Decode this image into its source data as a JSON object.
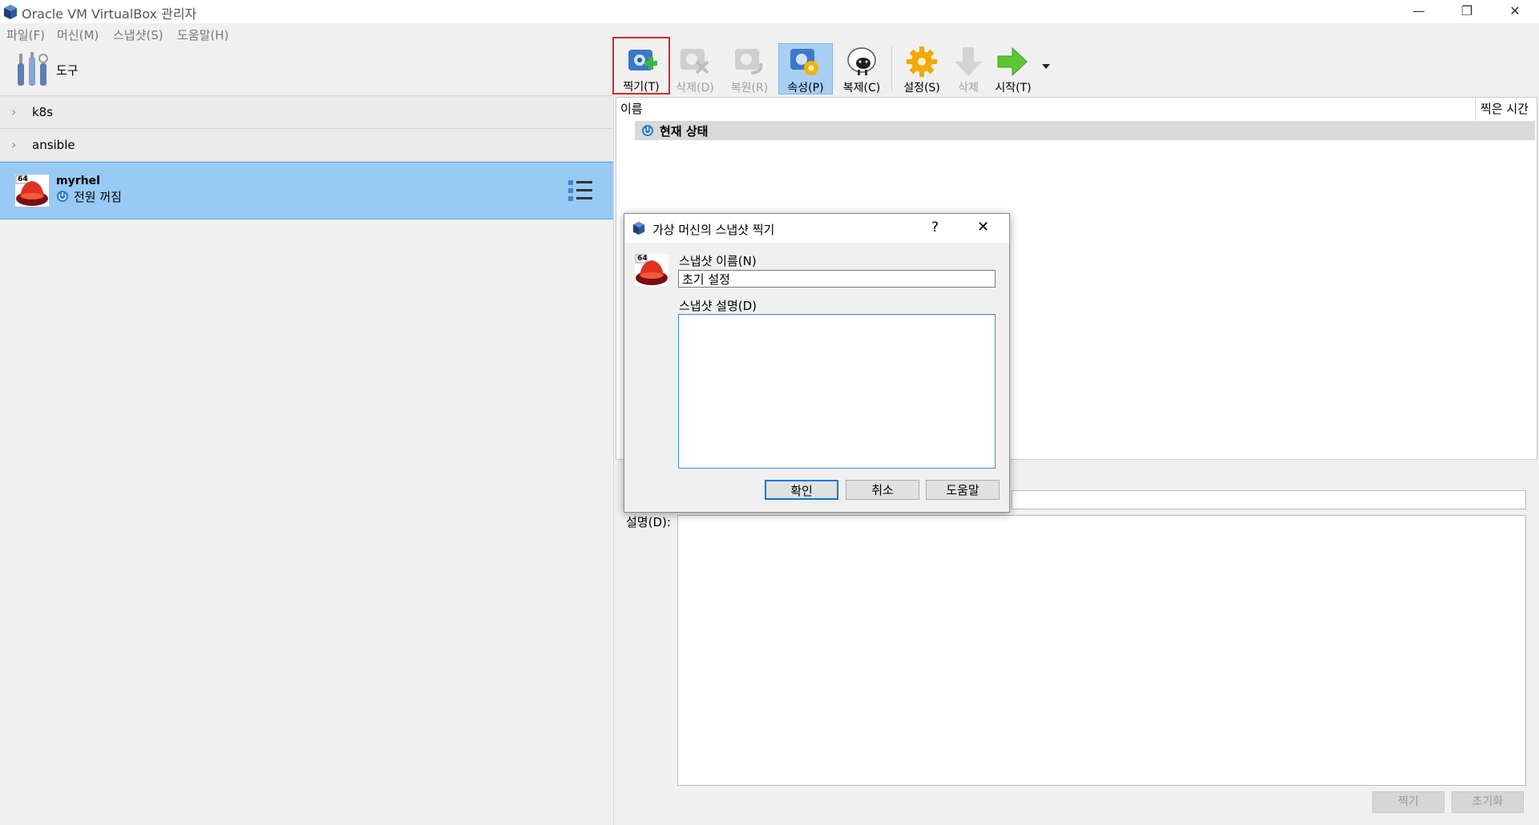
{
  "window": {
    "title": "Oracle VM VirtualBox 관리자",
    "minimize_glyph": "—",
    "restore_glyph": "❐",
    "close_glyph": "✕"
  },
  "menu": [
    "파일(F)",
    "머신(M)",
    "스냅샷(S)",
    "도움말(H)"
  ],
  "sidebar": {
    "tools_label": "도구",
    "groups": [
      "k8s",
      "ansible"
    ],
    "vm": {
      "name": "myrhel",
      "state": "전원 꺼짐",
      "badge": "64"
    }
  },
  "toolbar": {
    "buttons": [
      {
        "label": "찍기(T)",
        "icon": "take-snapshot-icon",
        "enabled": true,
        "highlighted": true
      },
      {
        "label": "삭제(D)",
        "icon": "delete-snapshot-icon",
        "enabled": false
      },
      {
        "label": "복원(R)",
        "icon": "restore-snapshot-icon",
        "enabled": false
      },
      {
        "label": "속성(P)",
        "icon": "snapshot-properties-icon",
        "enabled": true,
        "pressed": true
      },
      {
        "label": "복제(C)",
        "icon": "clone-sheep-icon",
        "enabled": true
      },
      {
        "label": "설정(S)",
        "icon": "settings-gear-icon",
        "enabled": true
      },
      {
        "label": "삭제",
        "icon": "discard-arrow-icon",
        "enabled": false
      },
      {
        "label": "시작(T)",
        "icon": "start-arrow-icon",
        "enabled": true
      }
    ]
  },
  "snapshot_tree": {
    "col_name": "이름",
    "col_time": "찍은 시간",
    "rows": [
      "현재 상태"
    ]
  },
  "details": {
    "desc_label": "설명(D):",
    "take_button": "찍기",
    "reset_button": "초기화"
  },
  "dialog": {
    "title": "가상 머신의 스냅샷 찍기",
    "help": "?",
    "close": "✕",
    "name_label": "스냅샷 이름(N)",
    "name_value": "초기 설정",
    "desc_label": "스냅샷 설명(D)",
    "desc_value": "",
    "ok": "확인",
    "cancel": "취소",
    "help_button": "도움말",
    "badge": "64"
  },
  "colors": {
    "selection": "#99c9f5",
    "highlight_border": "#e0242b",
    "focus_border": "#0078d7"
  }
}
